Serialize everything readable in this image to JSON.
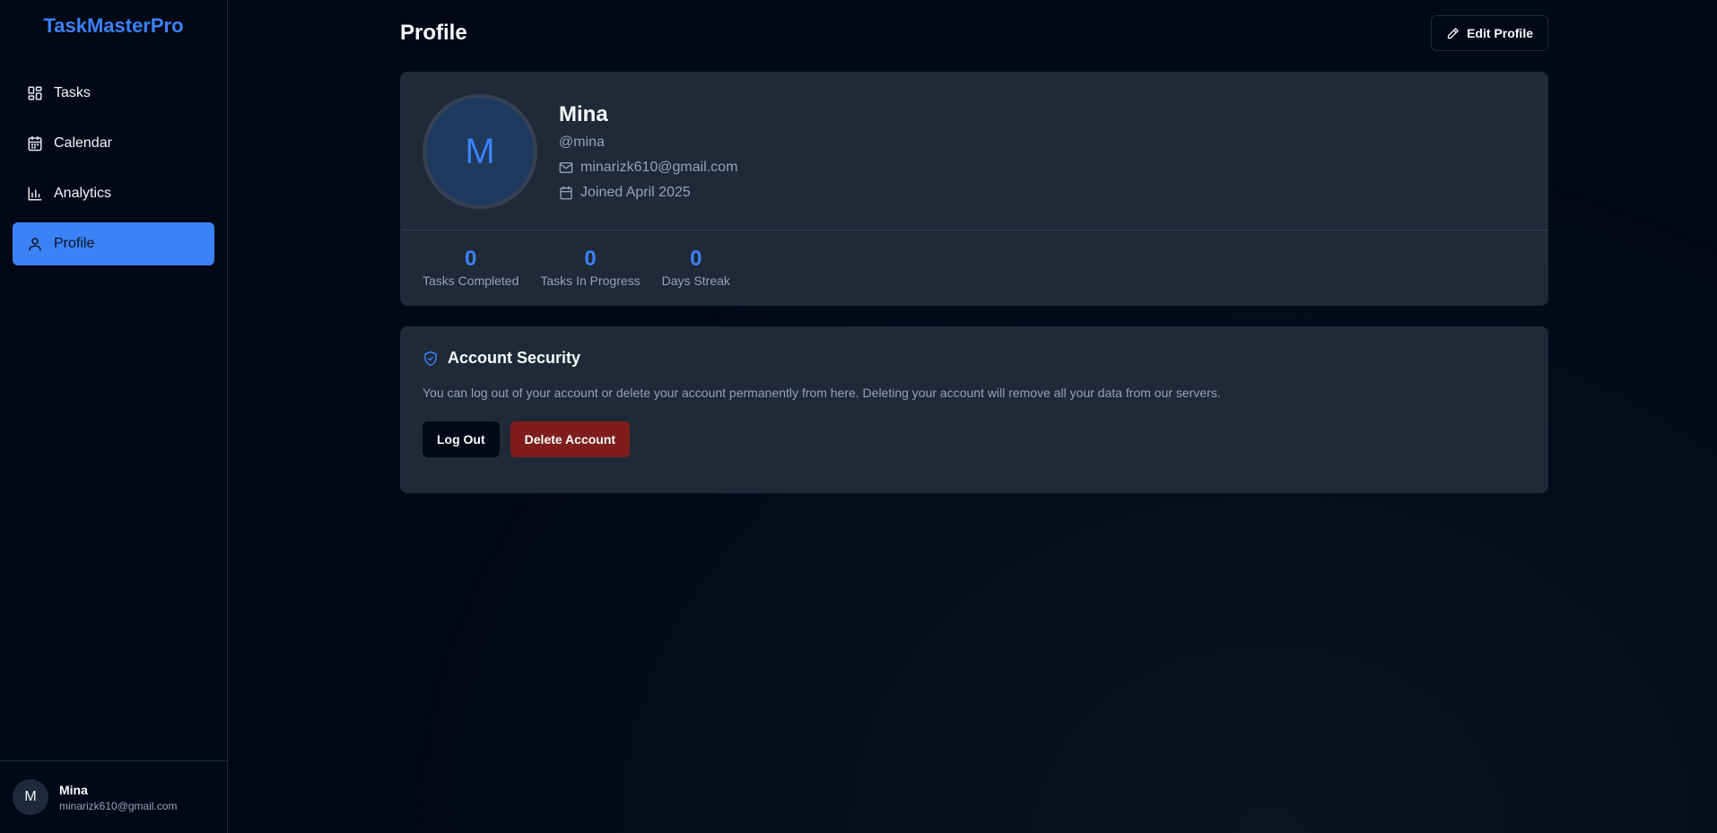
{
  "app": {
    "name": "TaskMasterPro"
  },
  "sidebar": {
    "items": [
      {
        "label": "Tasks",
        "icon": "dashboard-icon",
        "active": false
      },
      {
        "label": "Calendar",
        "icon": "calendar-icon",
        "active": false
      },
      {
        "label": "Analytics",
        "icon": "bar-chart-icon",
        "active": false
      },
      {
        "label": "Profile",
        "icon": "user-icon",
        "active": true
      }
    ],
    "user": {
      "initial": "M",
      "name": "Mina",
      "email": "minarizk610@gmail.com"
    }
  },
  "header": {
    "title": "Profile",
    "edit_label": "Edit Profile"
  },
  "profile": {
    "initial": "M",
    "name": "Mina",
    "handle": "@mina",
    "email": "minarizk610@gmail.com",
    "joined": "Joined April 2025",
    "stats": [
      {
        "value": "0",
        "label": "Tasks Completed"
      },
      {
        "value": "0",
        "label": "Tasks In Progress"
      },
      {
        "value": "0",
        "label": "Days Streak"
      }
    ]
  },
  "security": {
    "title": "Account Security",
    "description": "You can log out of your account or delete your account permanently from here. Deleting your account will remove all your data from our servers.",
    "logout_label": "Log Out",
    "delete_label": "Delete Account"
  },
  "colors": {
    "accent": "#3b82f6",
    "background": "#030817",
    "card": "#1f2937",
    "danger": "#7f1d1d"
  }
}
